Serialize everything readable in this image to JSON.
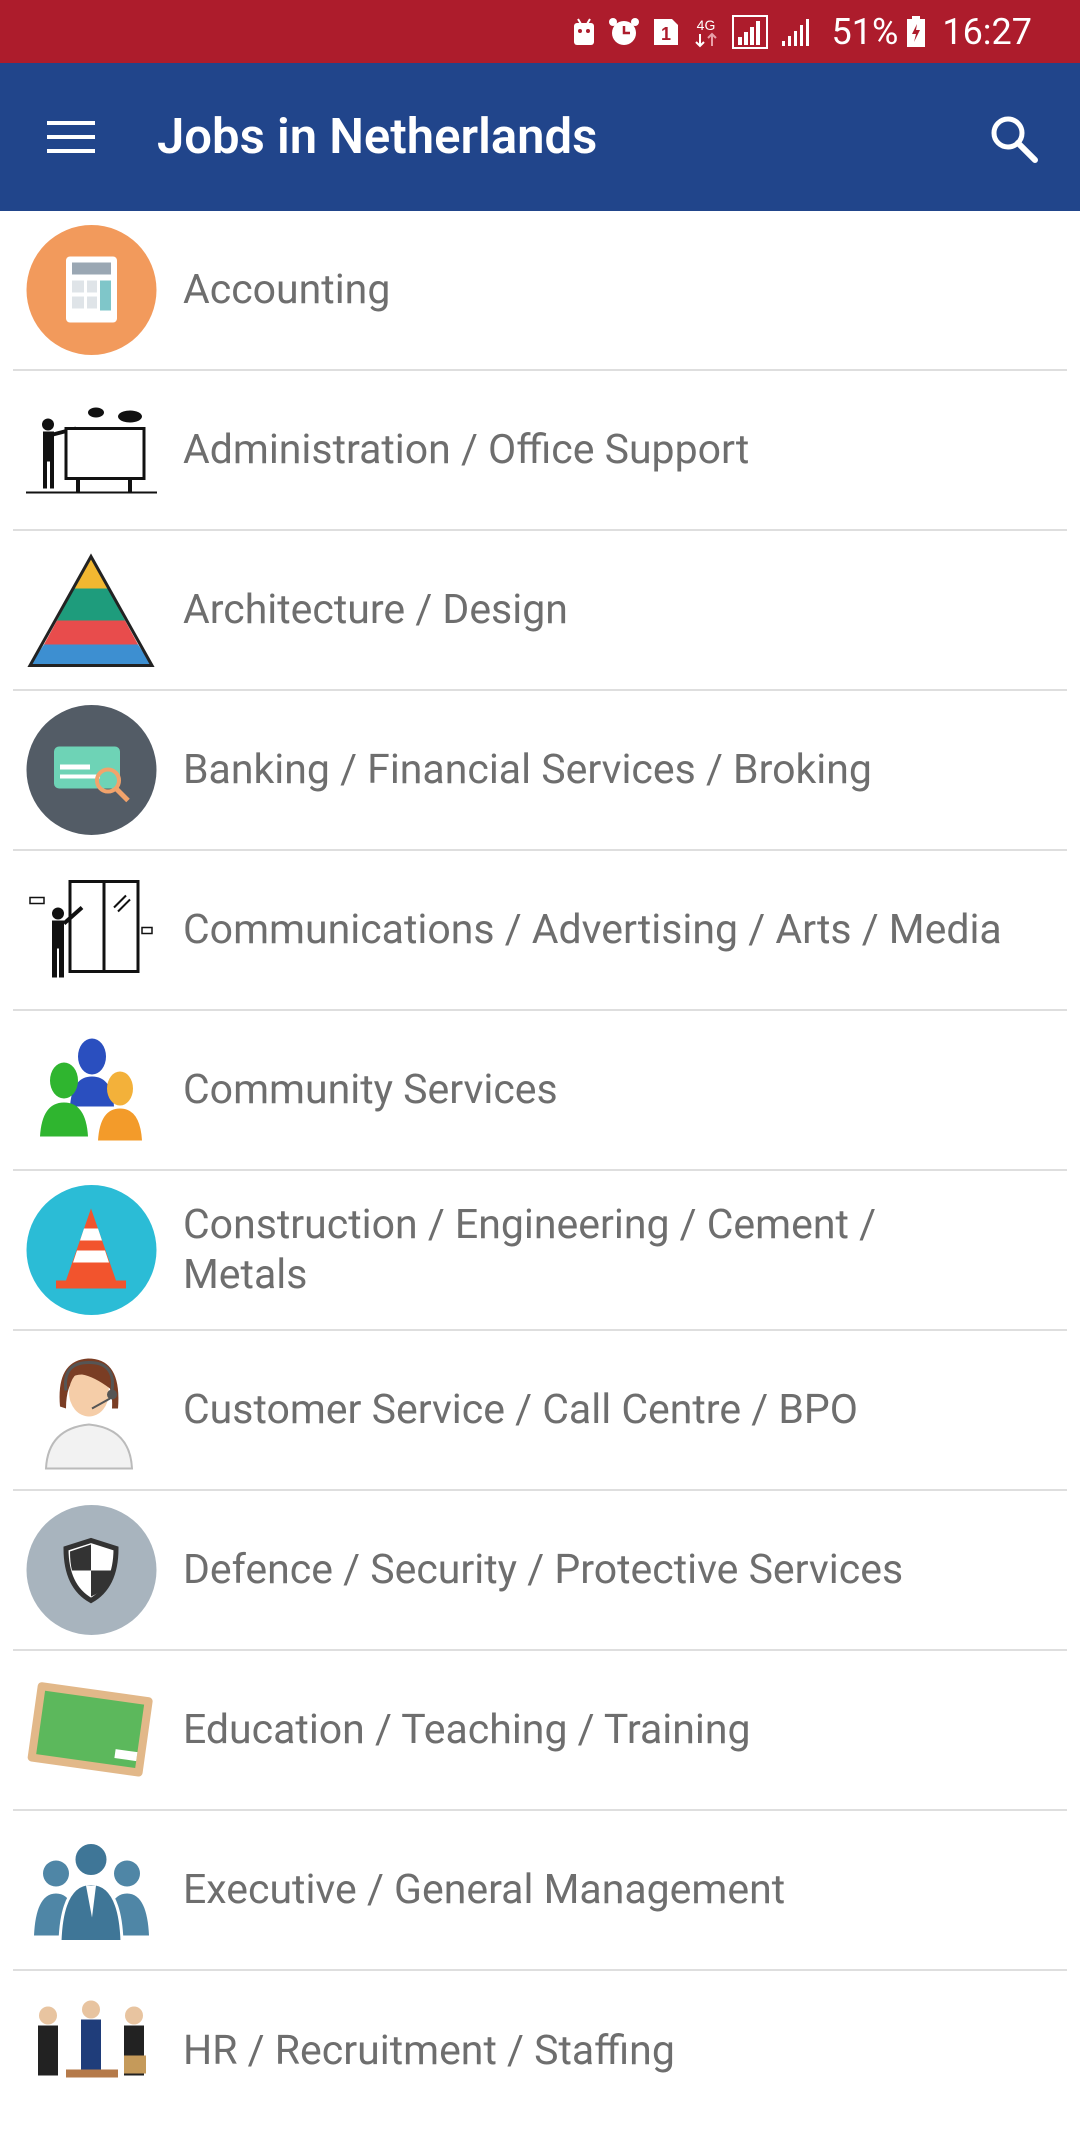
{
  "status_bar": {
    "icons": [
      "android-robot-icon",
      "alarm-icon",
      "sim1-icon",
      "network-4g-icon",
      "signal-icon",
      "signal-icon-2",
      "battery-icon"
    ],
    "network": "4G",
    "battery_percent": "51%",
    "time": "16:27",
    "colors": {
      "background": "#ad1c2c"
    }
  },
  "app_bar": {
    "title": "Jobs in Netherlands",
    "menu_icon": "hamburger-menu-icon",
    "search_icon": "search-icon",
    "colors": {
      "background": "#21458b",
      "text": "#ffffff"
    }
  },
  "categories": [
    {
      "label": "Accounting",
      "icon": "calculator-icon"
    },
    {
      "label": "Administration / Office Support",
      "icon": "presenter-board-icon"
    },
    {
      "label": "Architecture / Design",
      "icon": "pyramid-icon"
    },
    {
      "label": "Banking / Financial Services / Broking",
      "icon": "cheque-icon"
    },
    {
      "label": "Communications / Advertising / Arts / Media",
      "icon": "artist-window-icon"
    },
    {
      "label": "Community Services",
      "icon": "people-group-icon"
    },
    {
      "label": "Construction / Engineering / Cement /\nMetals",
      "icon": "traffic-cone-icon"
    },
    {
      "label": "Customer Service / Call Centre / BPO",
      "icon": "call-center-agent-icon"
    },
    {
      "label": "Defence / Security / Protective Services",
      "icon": "shield-icon"
    },
    {
      "label": "Education / Teaching / Training",
      "icon": "chalkboard-icon"
    },
    {
      "label": "Executive / General Management",
      "icon": "business-team-icon"
    },
    {
      "label": "HR / Recruitment / Staffing",
      "icon": "staff-people-icon"
    }
  ]
}
